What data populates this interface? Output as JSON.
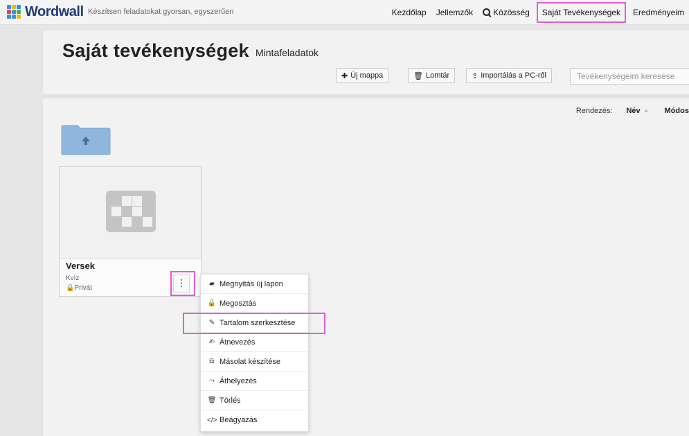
{
  "app": {
    "logo_text": "Wordwall",
    "tagline": "Készítsen feladatokat gyorsan, egyszerűen"
  },
  "nav": {
    "home": "Kezdőlap",
    "features": "Jellemzők",
    "community": "Közösség",
    "my_activities": "Saját Tevékenységek",
    "results": "Eredményeim"
  },
  "page": {
    "title": "Saját tevékenységek",
    "breadcrumb": "Mintafeladatok"
  },
  "toolbar": {
    "new_folder": "Új mappa",
    "trash": "Lomtár",
    "import": "Importálás a PC-ről",
    "search_placeholder": "Tevékenységeim keresése"
  },
  "sort": {
    "label": "Rendezés:",
    "name": "Név",
    "modified": "Módos"
  },
  "activity": {
    "title": "Versek",
    "type": "Kvíz",
    "privacy": "Privát"
  },
  "context_menu": [
    {
      "label": "Megnyitás új lapon",
      "icon": "folder-open-icon"
    },
    {
      "label": "Megosztás",
      "icon": "lock-icon"
    },
    {
      "label": "Tartalom szerkesztése",
      "icon": "pencil-icon"
    },
    {
      "label": "Átnevezés",
      "icon": "edit-icon"
    },
    {
      "label": "Másolat készítése",
      "icon": "copy-icon"
    },
    {
      "label": "Áthelyezés",
      "icon": "move-icon"
    },
    {
      "label": "Törlés",
      "icon": "trash-icon"
    },
    {
      "label": "Beágyazás",
      "icon": "code-icon"
    }
  ],
  "colors": {
    "highlight": "#e25ad8",
    "folder": "#8fb6dc",
    "brand": "#1f3c78"
  }
}
